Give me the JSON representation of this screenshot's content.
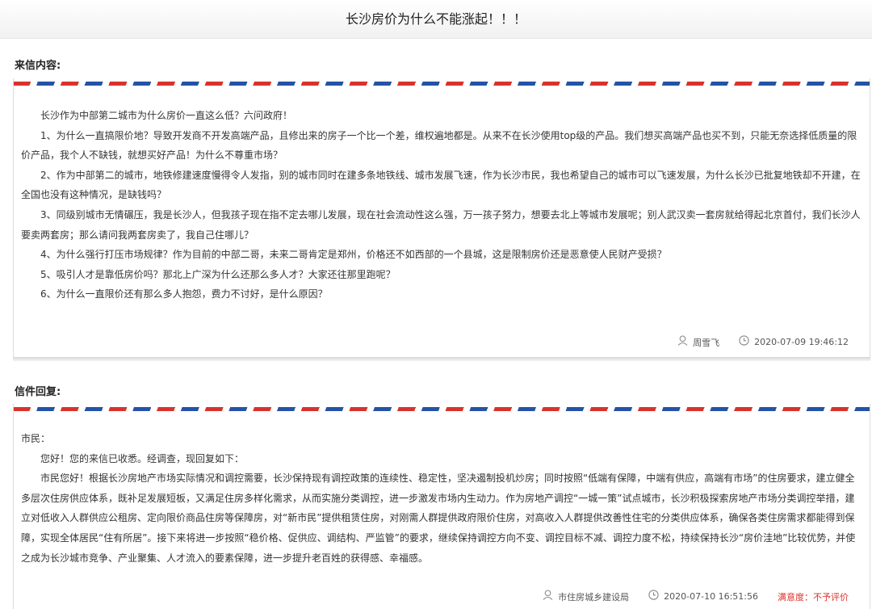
{
  "page_title": "长沙房价为什么不能涨起！！！",
  "letter": {
    "label": "来信内容:",
    "paragraphs": [
      "长沙作为中部第二城市为什么房价一直这么低？六问政府！",
      "1、为什么一直搞限价地？导致开发商不开发高端产品，且修出来的房子一个比一个差，维权遍地都是。从来不在长沙使用top级的产品。我们想买高端产品也买不到，只能无奈选择低质量的限价产品，我个人不缺钱，就想买好产品！为什么不尊重市场？",
      "2、作为中部第二的城市，地铁修建速度慢得令人发指，别的城市同时在建多条地铁线、城市发展飞速，作为长沙市民，我也希望自己的城市可以飞速发展，为什么长沙已批复地铁却不开建，在全国也没有这种情况，是缺钱吗？",
      "3、同级别城市无情碾压，我是长沙人，但我孩子现在指不定去哪儿发展，现在社会流动性这么强，万一孩子努力，想要去北上等城市发展呢；别人武汉卖一套房就给得起北京首付，我们长沙人要卖两套房；那么请问我两套房卖了，我自己住哪儿？",
      "4、为什么强行打压市场规律？作为目前的中部二哥，未来二哥肯定是郑州，价格还不如西部的一个县城，这是限制房价还是恶意使人民财产受损？",
      "5、吸引人才是靠低房价吗？那北上广深为什么还那么多人才？大家还往那里跑呢？",
      "6、为什么一直限价还有那么多人抱怨，费力不讨好，是什么原因？"
    ],
    "author": "周雪飞",
    "time": "2020-07-09 19:46:12"
  },
  "reply": {
    "label": "信件回复:",
    "greeting": "市民：",
    "paragraphs": [
      "您好！您的来信已收悉。经调查，现回复如下：",
      "市民您好！根据长沙房地产市场实际情况和调控需要，长沙保持现有调控政策的连续性、稳定性，坚决遏制投机炒房；同时按照“低端有保障，中端有供应，高端有市场”的住房要求，建立健全多层次住房供应体系，既补足发展短板，又满足住房多样化需求，从而实施分类调控，进一步激发市场内生动力。作为房地产调控“一城一策”试点城市，长沙积极探索房地产市场分类调控举措，建立对低收入人群供应公租房、定向限价商品住房等保障房，对“新市民”提供租赁住房，对刚需人群提供政府限价住房，对高收入人群提供改善性住宅的分类供应体系，确保各类住房需求都能得到保障，实现全体居民“住有所居”。接下来将进一步按照“稳价格、促供应、调结构、严监管”的要求，继续保持调控方向不变、调控目标不减、调控力度不松，持续保持长沙“房价洼地”比较优势，并使之成为长沙城市竞争、产业聚集、人才流入的要素保障，进一步提升老百姓的获得感、幸福感。"
    ],
    "department": "市住房城乡建设局",
    "time": "2020-07-10 16:51:56",
    "satisfaction": "满意度：不予评价"
  },
  "icons": {
    "user": "user-icon",
    "clock": "clock-icon"
  },
  "colors": {
    "stripe_red": "#d8332b",
    "stripe_blue": "#2553a6",
    "satisfaction": "#d9342b"
  }
}
